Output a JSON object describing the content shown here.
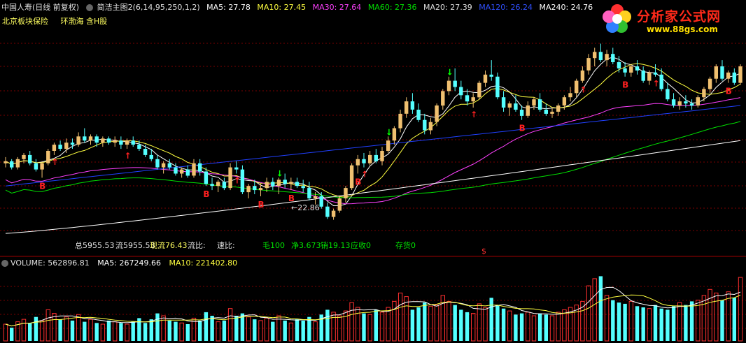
{
  "header": {
    "stock_name": "中国人寿(日线 前复权)",
    "indicator_name": "简洁主图2(6,14,95,250,1,2)",
    "ma5": "MA5: 27.78",
    "ma10": "MA10: 27.45",
    "ma30": "MA30: 27.64",
    "ma60": "MA60: 27.36",
    "ma20": "MA20: 27.39",
    "ma120": "MA120: 26.24",
    "ma240": "MA240: 24.76"
  },
  "tags": {
    "sector1": "北京板块",
    "sector2": "保险",
    "sector3": "环渤海",
    "sector4": "含H股"
  },
  "info_row": {
    "total": "总5955.53",
    "float": "流5955.53",
    "current_float": "现流76.43",
    "float_ratio": "流比:",
    "speed_ratio": "速比:",
    "gross": "毛100",
    "net": "净3.673",
    "sales": "销19.13",
    "receivable": "应收0",
    "inventory": "存货0",
    "dollar_mark": "$"
  },
  "low_label": "22.86",
  "volume_header": {
    "volume": "VOLUME: 562896.81",
    "ma5": "MA5: 267249.66",
    "ma10": "MA10: 221402.80"
  },
  "logo": {
    "title": "分析家公式网",
    "url": "www.88gs.com"
  },
  "colors": {
    "up_candle": "#f0c070",
    "down_candle": "#54ffff",
    "ma5": "#ffffff",
    "ma10": "#ffff40",
    "ma30": "#ff40ff",
    "ma60": "#00e000",
    "ma120": "#2040ff",
    "ma240": "#ffffff",
    "signal_red": "#ff2020",
    "signal_green": "#00ff00",
    "vol_up": "#ff3030",
    "vol_down": "#54ffff"
  },
  "chart_data": {
    "type": "candlestick",
    "candles": [
      [
        25.6,
        25.9,
        25.4,
        25.7
      ],
      [
        25.7,
        25.8,
        25.3,
        25.4
      ],
      [
        25.4,
        25.9,
        25.3,
        25.8
      ],
      [
        25.8,
        26.1,
        25.6,
        26.0
      ],
      [
        26.0,
        26.2,
        25.5,
        25.6
      ],
      [
        25.6,
        25.8,
        25.2,
        25.3
      ],
      [
        25.3,
        25.7,
        24.9,
        25.6
      ],
      [
        25.6,
        26.3,
        25.5,
        26.2
      ],
      [
        26.2,
        26.6,
        26.0,
        26.5
      ],
      [
        26.5,
        26.7,
        26.2,
        26.3
      ],
      [
        26.3,
        26.8,
        26.1,
        26.6
      ],
      [
        26.6,
        26.8,
        26.3,
        26.5
      ],
      [
        26.5,
        27.1,
        26.4,
        26.9
      ],
      [
        26.9,
        27.3,
        26.6,
        26.7
      ],
      [
        26.7,
        27.0,
        26.5,
        26.9
      ],
      [
        26.9,
        27.0,
        26.4,
        26.6
      ],
      [
        26.6,
        26.9,
        26.4,
        26.8
      ],
      [
        26.8,
        26.9,
        26.5,
        26.6
      ],
      [
        26.6,
        26.9,
        26.4,
        26.7
      ],
      [
        26.7,
        26.9,
        26.3,
        26.5
      ],
      [
        26.5,
        26.8,
        26.3,
        26.7
      ],
      [
        26.7,
        26.9,
        26.4,
        26.5
      ],
      [
        26.5,
        26.7,
        26.2,
        26.3
      ],
      [
        26.3,
        26.5,
        25.9,
        26.0
      ],
      [
        26.0,
        26.3,
        25.7,
        25.8
      ],
      [
        25.8,
        26.0,
        25.3,
        25.4
      ],
      [
        25.4,
        25.7,
        25.1,
        25.6
      ],
      [
        25.6,
        25.8,
        25.3,
        25.4
      ],
      [
        25.4,
        25.6,
        25.0,
        25.1
      ],
      [
        25.1,
        25.4,
        24.9,
        25.3
      ],
      [
        25.3,
        25.5,
        24.9,
        25.0
      ],
      [
        25.0,
        25.8,
        24.9,
        25.6
      ],
      [
        25.6,
        25.8,
        25.0,
        25.2
      ],
      [
        25.2,
        25.4,
        24.5,
        24.6
      ],
      [
        24.6,
        24.9,
        24.3,
        24.5
      ],
      [
        24.5,
        24.8,
        24.2,
        24.7
      ],
      [
        24.7,
        24.9,
        24.3,
        24.4
      ],
      [
        24.4,
        25.6,
        24.3,
        25.4
      ],
      [
        25.4,
        25.7,
        25.1,
        25.3
      ],
      [
        25.3,
        25.5,
        24.1,
        24.2
      ],
      [
        24.2,
        24.6,
        23.9,
        24.5
      ],
      [
        24.5,
        24.8,
        24.1,
        24.3
      ],
      [
        24.3,
        24.6,
        24.0,
        24.4
      ],
      [
        24.4,
        24.9,
        24.2,
        24.7
      ],
      [
        24.7,
        24.9,
        24.3,
        24.5
      ],
      [
        24.5,
        24.9,
        24.1,
        24.8
      ],
      [
        24.8,
        25.1,
        24.4,
        24.6
      ],
      [
        24.6,
        24.9,
        24.3,
        24.7
      ],
      [
        24.7,
        24.9,
        24.4,
        24.5
      ],
      [
        24.5,
        24.8,
        24.2,
        24.4
      ],
      [
        24.4,
        24.7,
        23.8,
        23.9
      ],
      [
        23.9,
        24.2,
        23.6,
        24.0
      ],
      [
        24.0,
        24.2,
        23.4,
        23.5
      ],
      [
        23.5,
        23.7,
        22.9,
        23.0
      ],
      [
        23.0,
        23.4,
        22.86,
        23.3
      ],
      [
        23.3,
        24.0,
        23.2,
        23.9
      ],
      [
        23.9,
        24.5,
        23.7,
        24.4
      ],
      [
        24.4,
        25.6,
        24.3,
        25.5
      ],
      [
        25.5,
        26.0,
        25.1,
        25.8
      ],
      [
        25.8,
        26.1,
        25.4,
        25.6
      ],
      [
        25.6,
        26.2,
        25.5,
        26.0
      ],
      [
        26.0,
        26.3,
        25.6,
        25.7
      ],
      [
        25.7,
        26.4,
        25.5,
        26.2
      ],
      [
        26.2,
        26.9,
        26.1,
        26.7
      ],
      [
        26.7,
        27.4,
        26.5,
        27.3
      ],
      [
        27.3,
        28.2,
        27.1,
        28.0
      ],
      [
        28.0,
        28.8,
        27.8,
        28.6
      ],
      [
        28.6,
        29.0,
        28.0,
        28.2
      ],
      [
        28.2,
        28.5,
        27.6,
        27.7
      ],
      [
        27.7,
        28.0,
        27.0,
        27.2
      ],
      [
        27.2,
        27.8,
        27.0,
        27.6
      ],
      [
        27.6,
        28.5,
        27.4,
        28.4
      ],
      [
        28.4,
        29.2,
        28.2,
        29.1
      ],
      [
        29.1,
        29.8,
        28.9,
        29.6
      ],
      [
        29.6,
        30.2,
        29.1,
        29.3
      ],
      [
        29.3,
        29.6,
        28.7,
        28.9
      ],
      [
        28.9,
        29.2,
        28.4,
        28.6
      ],
      [
        28.6,
        29.0,
        28.3,
        28.8
      ],
      [
        28.8,
        29.6,
        28.7,
        29.5
      ],
      [
        29.5,
        30.1,
        29.3,
        29.9
      ],
      [
        29.9,
        30.6,
        29.6,
        29.8
      ],
      [
        29.8,
        30.0,
        28.7,
        28.8
      ],
      [
        28.8,
        29.1,
        28.1,
        28.3
      ],
      [
        28.3,
        28.6,
        27.9,
        28.5
      ],
      [
        28.5,
        28.9,
        28.1,
        28.2
      ],
      [
        28.2,
        28.4,
        27.7,
        27.9
      ],
      [
        27.9,
        28.6,
        27.8,
        28.4
      ],
      [
        28.4,
        28.8,
        28.2,
        28.7
      ],
      [
        28.7,
        29.0,
        28.1,
        28.2
      ],
      [
        28.2,
        28.5,
        27.9,
        28.0
      ],
      [
        28.0,
        28.3,
        27.8,
        28.1
      ],
      [
        28.1,
        28.5,
        27.9,
        28.4
      ],
      [
        28.4,
        28.9,
        28.2,
        28.8
      ],
      [
        28.8,
        29.3,
        28.6,
        29.0
      ],
      [
        29.0,
        29.7,
        28.8,
        29.6
      ],
      [
        29.6,
        30.3,
        29.5,
        30.1
      ],
      [
        30.1,
        30.9,
        29.9,
        30.7
      ],
      [
        30.7,
        31.2,
        30.3,
        31.0
      ],
      [
        31.0,
        31.4,
        30.5,
        30.6
      ],
      [
        30.6,
        31.1,
        30.3,
        30.9
      ],
      [
        30.9,
        31.2,
        30.4,
        30.5
      ],
      [
        30.5,
        30.8,
        30.0,
        30.2
      ],
      [
        30.2,
        30.5,
        29.8,
        30.0
      ],
      [
        30.0,
        30.4,
        29.8,
        30.3
      ],
      [
        30.3,
        30.6,
        29.9,
        30.1
      ],
      [
        30.1,
        30.3,
        29.5,
        29.6
      ],
      [
        29.6,
        30.1,
        29.4,
        30.0
      ],
      [
        30.0,
        30.4,
        29.8,
        29.9
      ],
      [
        29.9,
        30.2,
        29.1,
        29.2
      ],
      [
        29.2,
        29.5,
        28.6,
        28.7
      ],
      [
        28.7,
        29.0,
        28.3,
        28.4
      ],
      [
        28.4,
        28.8,
        28.2,
        28.6
      ],
      [
        28.6,
        28.9,
        28.3,
        28.5
      ],
      [
        28.5,
        28.7,
        28.2,
        28.4
      ],
      [
        28.4,
        28.9,
        28.3,
        28.8
      ],
      [
        28.8,
        29.3,
        28.6,
        29.2
      ],
      [
        29.2,
        29.8,
        29.0,
        29.7
      ],
      [
        29.7,
        30.4,
        29.5,
        30.3
      ],
      [
        30.3,
        30.6,
        29.6,
        29.7
      ],
      [
        29.7,
        30.1,
        29.5,
        30.0
      ],
      [
        30.0,
        30.2,
        29.4,
        29.5
      ],
      [
        29.5,
        30.4,
        29.4,
        30.3
      ]
    ],
    "volume": [
      140,
      110,
      160,
      180,
      150,
      200,
      170,
      260,
      230,
      180,
      200,
      170,
      220,
      160,
      180,
      150,
      140,
      170,
      160,
      150,
      140,
      160,
      190,
      150,
      180,
      230,
      210,
      170,
      160,
      150,
      140,
      190,
      170,
      240,
      210,
      160,
      170,
      270,
      210,
      230,
      200,
      180,
      170,
      190,
      160,
      210,
      170,
      150,
      180,
      170,
      200,
      160,
      220,
      260,
      240,
      210,
      250,
      320,
      280,
      230,
      220,
      260,
      240,
      280,
      330,
      400,
      370,
      260,
      280,
      320,
      290,
      300,
      380,
      330,
      300,
      260,
      240,
      230,
      310,
      280,
      360,
      300,
      270,
      250,
      220,
      230,
      240,
      210,
      230,
      220,
      210,
      240,
      260,
      280,
      300,
      330,
      460,
      520,
      540,
      380,
      340,
      320,
      310,
      330,
      290,
      280,
      270,
      300,
      270,
      260,
      290,
      320,
      300,
      330,
      340,
      380,
      430,
      400,
      340,
      410,
      360,
      530
    ],
    "ylim": [
      22.0,
      32.5
    ],
    "vol_ylim": [
      0,
      560
    ]
  }
}
